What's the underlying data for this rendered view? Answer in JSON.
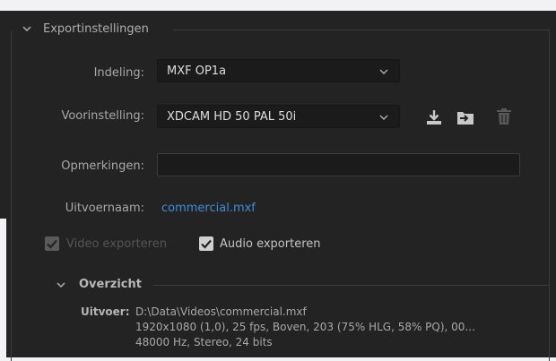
{
  "section": {
    "title": "Exportinstellingen"
  },
  "format": {
    "label": "Indeling:",
    "value": "MXF OP1a"
  },
  "preset": {
    "label": "Voorinstelling:",
    "value": "XDCAM HD 50 PAL 50i"
  },
  "comments": {
    "label": "Opmerkingen:",
    "value": ""
  },
  "output": {
    "label": "Uitvoernaam:",
    "filename": "commercial.mxf"
  },
  "checkboxes": {
    "video": {
      "label": "Video exporteren",
      "checked": true,
      "enabled": false
    },
    "audio": {
      "label": "Audio exporteren",
      "checked": true,
      "enabled": true
    }
  },
  "summary": {
    "title": "Overzicht",
    "output_label": "Uitvoer:",
    "path": "D:\\Data\\Videos\\commercial.mxf",
    "video_line": "1920x1080 (1,0), 25 fps, Boven, 203 (75% HLG, 58% PQ), 00...",
    "audio_line": "48000 Hz, Stereo, 24 bits"
  },
  "icons": {
    "save_preset": "download-icon",
    "import_preset": "import-folder-icon",
    "delete_preset": "trash-icon"
  }
}
